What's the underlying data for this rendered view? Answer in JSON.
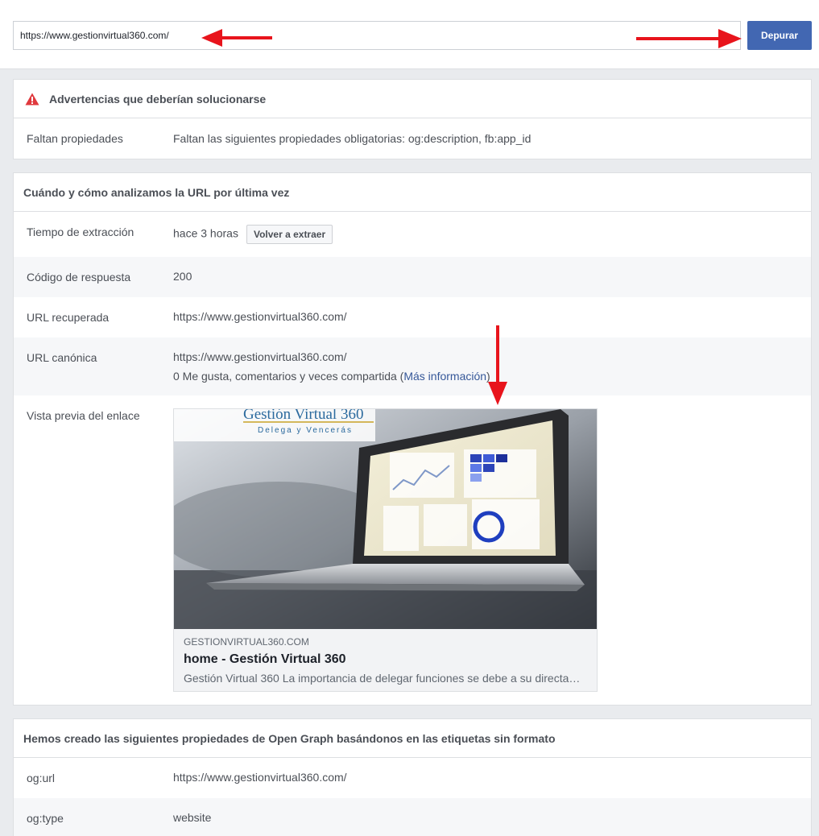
{
  "debugger": {
    "url_value": "https://www.gestionvirtual360.com/",
    "debug_button": "Depurar"
  },
  "warnings": {
    "title": "Advertencias que deberían solucionarse",
    "icon": "warning-triangle-icon",
    "rows": [
      {
        "label": "Faltan propiedades",
        "value": "Faltan las siguientes propiedades obligatorias: og:description, fb:app_id"
      }
    ]
  },
  "scrape": {
    "title": "Cuándo y cómo analizamos la URL por última vez",
    "fetch_time_label": "Tiempo de extracción",
    "fetch_time_value": "hace 3 horas",
    "refetch_button": "Volver a extraer",
    "response_code_label": "Código de respuesta",
    "response_code_value": "200",
    "fetched_url_label": "URL recuperada",
    "fetched_url_value": "https://www.gestionvirtual360.com/",
    "canonical_url_label": "URL canónica",
    "canonical_url_value": "https://www.gestionvirtual360.com/",
    "engagement_text": "0 Me gusta, comentarios y veces compartida (",
    "more_info_link": "Más información",
    "engagement_close": ")",
    "preview_label": "Vista previa del enlace",
    "preview": {
      "image_brand": "Gestión Virtual 360",
      "image_tagline": "Delega y Vencerás",
      "domain": "GESTIONVIRTUAL360.COM",
      "title": "home - Gestión Virtual 360",
      "description": "Gestión Virtual 360 La importancia de delegar funciones se debe a su directa…"
    }
  },
  "opengraph": {
    "title": "Hemos creado las siguientes propiedades de Open Graph basándonos en las etiquetas sin formato",
    "rows": [
      {
        "label": "og:url",
        "value": "https://www.gestionvirtual360.com/"
      },
      {
        "label": "og:type",
        "value": "website"
      }
    ]
  },
  "colors": {
    "accent": "#4267b2",
    "link": "#365899",
    "annotation_red": "#e8141c",
    "page_bg": "#e9ebee"
  }
}
